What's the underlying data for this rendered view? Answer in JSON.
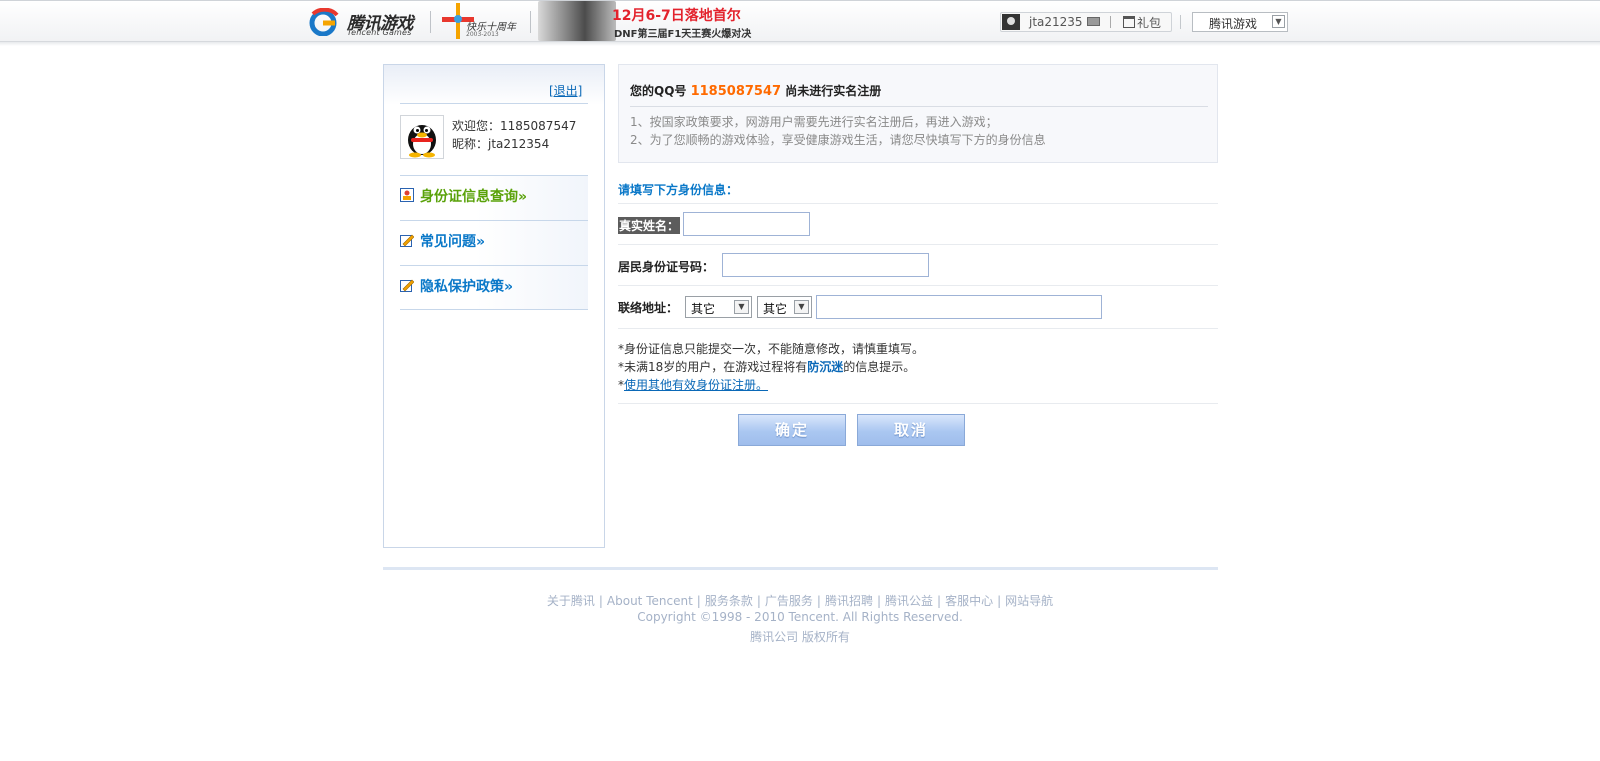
{
  "header": {
    "logo_cn": "腾讯游戏",
    "logo_en": "Tencent Games",
    "anniversary_text": "快乐十周年",
    "anniversary_years": "2003-2013",
    "banner_headline": "12月6-7日落地首尔",
    "banner_sub": "DNF第三届F1天王赛火爆对决",
    "username": "jta21235",
    "gift_label": "礼包",
    "game_select": "腾讯游戏"
  },
  "sidebar": {
    "logout": "[退出]",
    "welcome": "欢迎您：1185087547",
    "nickname": "昵称：jta212354",
    "items": [
      {
        "label": "身份证信息查询»",
        "icon": "id-card-icon"
      },
      {
        "label": "常见问题»",
        "icon": "pencil-icon"
      },
      {
        "label": "隐私保护政策»",
        "icon": "pencil-icon"
      }
    ]
  },
  "notice": {
    "prefix": "您的QQ号 ",
    "qq": "1185087547",
    "suffix": " 尚未进行实名注册",
    "line1": "1、按国家政策要求，网游用户需要先进行实名注册后，再进入游戏；",
    "line2": "2、为了您顺畅的游戏体验，享受健康游戏生活，请您尽快填写下方的身份信息"
  },
  "form": {
    "section_title": "请填写下方身份信息：",
    "name_label": "真实姓名：",
    "id_label": "居民身份证号码：",
    "address_label": "联络地址：",
    "province": "其它",
    "city": "其它",
    "name_value": "",
    "id_value": "",
    "address_value": ""
  },
  "notes": {
    "n1": "*身份证信息只能提交一次，不能随意修改，请慎重填写。",
    "n2_pre": "*未满18岁的用户，在游戏过程将有",
    "n2_bold": "防沉迷",
    "n2_post": "的信息提示。",
    "n3_star": "*",
    "n3_link": "使用其他有效身份证注册。"
  },
  "buttons": {
    "confirm": "确定",
    "cancel": "取消"
  },
  "footer": {
    "links": [
      "关于腾讯",
      "About Tencent",
      "服务条款",
      "广告服务",
      "腾讯招聘",
      "腾讯公益",
      "客服中心",
      "网站导航"
    ],
    "copyright": "Copyright ©1998 - 2010 Tencent. All Rights Reserved.",
    "owner": "腾讯公司 版权所有"
  },
  "colors": {
    "accent_blue": "#0a78c8",
    "qq_orange": "#ff6a00",
    "menu_green": "#5aa20a"
  }
}
